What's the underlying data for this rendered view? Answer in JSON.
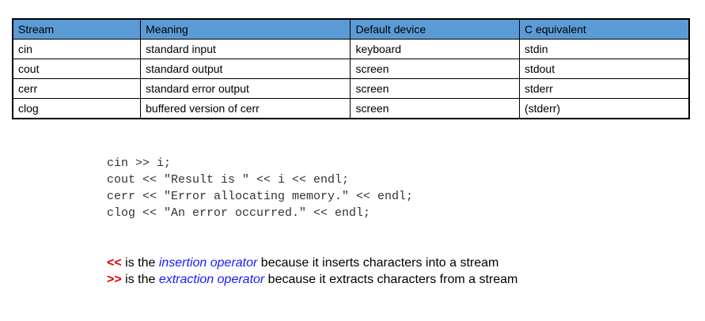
{
  "table": {
    "headers": [
      "Stream",
      "Meaning",
      "Default device",
      "C equivalent"
    ],
    "rows": [
      [
        "cin",
        "standard input",
        "keyboard",
        "stdin"
      ],
      [
        "cout",
        "standard output",
        "screen",
        "stdout"
      ],
      [
        "cerr",
        "standard error output",
        "screen",
        "stderr"
      ],
      [
        "clog",
        "buffered version of cerr",
        "screen",
        "(stderr)"
      ]
    ]
  },
  "code_lines": [
    "cin >> i;",
    "cout << \"Result is \" << i << endl;",
    "cerr << \"Error allocating memory.\" << endl;",
    "clog << \"An error occurred.\" << endl;"
  ],
  "notes": [
    {
      "op": "<<",
      "pre": " is the ",
      "term": "insertion operator",
      "post": " because it inserts characters into a stream"
    },
    {
      "op": ">>",
      "pre": " is the ",
      "term": "extraction operator",
      "post": " because it extracts characters from a stream"
    }
  ],
  "colors": {
    "header_bg": "#5b9bd5",
    "operator": "#e00000",
    "term": "#1a1aff",
    "code": "#333333"
  }
}
